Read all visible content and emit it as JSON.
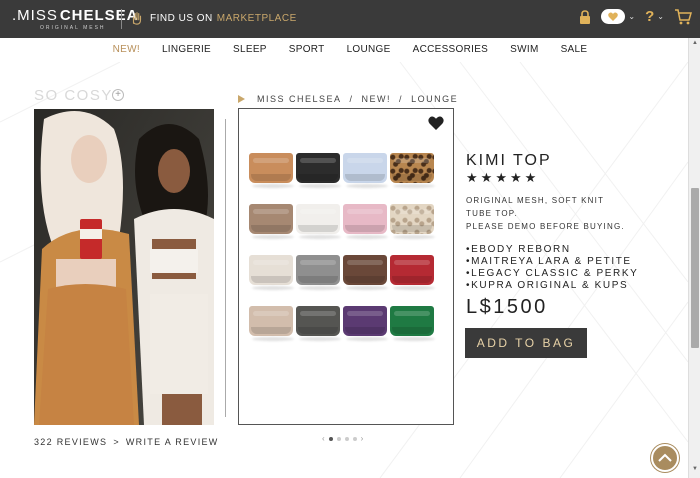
{
  "header": {
    "brand_prefix": ".MISS",
    "brand_name": "CHELSEA",
    "brand_tagline": "ORIGINAL MESH",
    "find_us_label": "FIND US ON",
    "marketplace_label": "MARKETPLACE",
    "help_label": "?"
  },
  "nav": {
    "items": [
      "NEW!",
      "LINGERIE",
      "SLEEP",
      "SPORT",
      "LOUNGE",
      "ACCESSORIES",
      "SWIM",
      "SALE"
    ],
    "active": "NEW!"
  },
  "left": {
    "collection_title": "SO COSY",
    "reviews_label": "322 REVIEWS",
    "reviews_sep": ">",
    "write_review_label": "WRITE A REVIEW"
  },
  "breadcrumb": [
    "MISS CHELSEA",
    "/",
    "NEW!",
    "/",
    "LOUNGE"
  ],
  "product": {
    "title": "KIMI TOP",
    "rating": 5,
    "description_lines": [
      "ORIGINAL MESH, SOFT KNIT",
      "TUBE TOP.",
      "PLEASE DEMO BEFORE BUYING."
    ],
    "bodies": [
      "•EBODY REBORN",
      "•MAITREYA LARA & PETITE",
      "•LEGACY CLASSIC & PERKY",
      "•KUPRA ORIGINAL & KUPS"
    ],
    "price": "L$1500",
    "add_to_bag_label": "ADD TO BAG",
    "swatch_colors": [
      [
        "#c98d5c",
        "#2c2c2c",
        "#c9d6ea",
        "leopard"
      ],
      [
        "#a68872",
        "#f1efec",
        "#e7b9c6",
        "leopard-light"
      ],
      [
        "#e6dfd6",
        "#8f8f8f",
        "#6a4839",
        "#b52a33"
      ],
      [
        "#d2bdac",
        "#555552",
        "#5b3a72",
        "#1f7a43"
      ]
    ]
  },
  "carousel": {
    "prev": "‹",
    "next": "›",
    "count": 5,
    "active": 1
  },
  "colors": {
    "accent": "#c9a76b",
    "topbar": "#3a3a3a",
    "button_text": "#e8d3a8"
  }
}
